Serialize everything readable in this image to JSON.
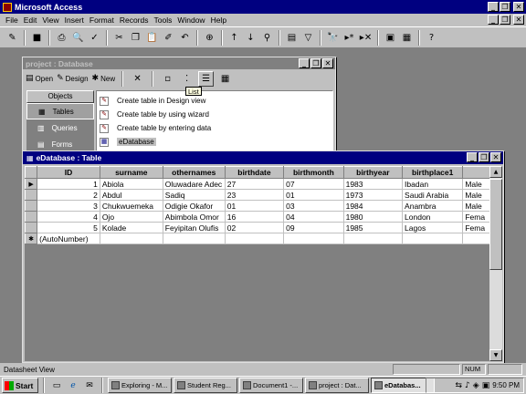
{
  "app": {
    "title": "Microsoft Access"
  },
  "window_buttons": {
    "minimize": "_",
    "restore": "❐",
    "close": "✕"
  },
  "menu": [
    "File",
    "Edit",
    "View",
    "Insert",
    "Format",
    "Records",
    "Tools",
    "Window",
    "Help"
  ],
  "toolbar": [
    {
      "name": "view-icon",
      "glyph": "✎"
    },
    {
      "name": "save-icon",
      "glyph": "■"
    },
    {
      "name": "print-icon",
      "glyph": "⎙"
    },
    {
      "name": "print-preview-icon",
      "glyph": "🔍"
    },
    {
      "name": "spelling-icon",
      "glyph": "✓"
    },
    {
      "name": "cut-icon",
      "glyph": "✂"
    },
    {
      "name": "copy-icon",
      "glyph": "❐"
    },
    {
      "name": "paste-icon",
      "glyph": "📋"
    },
    {
      "name": "format-painter-icon",
      "glyph": "✐"
    },
    {
      "name": "undo-icon",
      "glyph": "↶"
    },
    {
      "name": "hyperlink-icon",
      "glyph": "⊕"
    },
    {
      "name": "sort-ascending-icon",
      "glyph": "↑"
    },
    {
      "name": "sort-descending-icon",
      "glyph": "↓"
    },
    {
      "name": "filter-by-selection-icon",
      "glyph": "⚲"
    },
    {
      "name": "filter-by-form-icon",
      "glyph": "▤"
    },
    {
      "name": "apply-filter-icon",
      "glyph": "▽"
    },
    {
      "name": "find-icon",
      "glyph": "🔭"
    },
    {
      "name": "new-record-icon",
      "glyph": "▸*"
    },
    {
      "name": "delete-record-icon",
      "glyph": "▸✕"
    },
    {
      "name": "database-window-icon",
      "glyph": "▣"
    },
    {
      "name": "new-object-icon",
      "glyph": "▦"
    },
    {
      "name": "help-icon",
      "glyph": "?"
    }
  ],
  "db_window": {
    "title": "project : Database",
    "tools": [
      {
        "name": "open-button",
        "label": "Open",
        "glyph": "▤"
      },
      {
        "name": "design-button",
        "label": "Design",
        "glyph": "✎"
      },
      {
        "name": "new-button",
        "label": "New",
        "glyph": "✱"
      }
    ],
    "objects_header": "Objects",
    "objects": [
      {
        "label": "Tables",
        "glyph": "▦"
      },
      {
        "label": "Queries",
        "glyph": "▥"
      },
      {
        "label": "Forms",
        "glyph": "▤"
      }
    ],
    "list": [
      "Create table in Design view",
      "Create table by using wizard",
      "Create table by entering data",
      "eDatabase"
    ],
    "tooltip": "List"
  },
  "table_window": {
    "title": "eDatabase : Table",
    "columns": [
      "ID",
      "surname",
      "othernames",
      "birthdate",
      "birthmonth",
      "birthyear",
      "birthplace1",
      ""
    ],
    "rows": [
      [
        "1",
        "Abiola",
        "Oluwadare Adec",
        "27",
        "07",
        "1983",
        "Ibadan",
        "Male"
      ],
      [
        "2",
        "Abdul",
        "Sadiq",
        "23",
        "01",
        "1973",
        "Saudi Arabia",
        "Male"
      ],
      [
        "3",
        "Chukwuemeka",
        "Odigie Okafor",
        "01",
        "03",
        "1984",
        "Anambra",
        "Male"
      ],
      [
        "4",
        "Ojo",
        "Abimbola Omor",
        "16",
        "04",
        "1980",
        "London",
        "Fema"
      ],
      [
        "5",
        "Kolade",
        "Feyipitan Olufis",
        "02",
        "09",
        "1985",
        "Lagos",
        "Fema"
      ]
    ],
    "new_row": [
      "(AutoNumber)",
      "",
      "",
      "",
      "",
      "",
      "",
      ""
    ],
    "selectors": {
      "current": "▶",
      "new": "✱"
    }
  },
  "statusbar": {
    "text": "Datasheet View",
    "num": "NUM"
  },
  "taskbar": {
    "start": "Start",
    "tasks": [
      {
        "label": "Exploring - M...",
        "active": false
      },
      {
        "label": "Student Reg...",
        "active": false
      },
      {
        "label": "Document1 -...",
        "active": false
      },
      {
        "label": "project : Dat...",
        "active": false
      },
      {
        "label": "eDatabas...",
        "active": true
      }
    ],
    "clock": "9:50 PM"
  }
}
